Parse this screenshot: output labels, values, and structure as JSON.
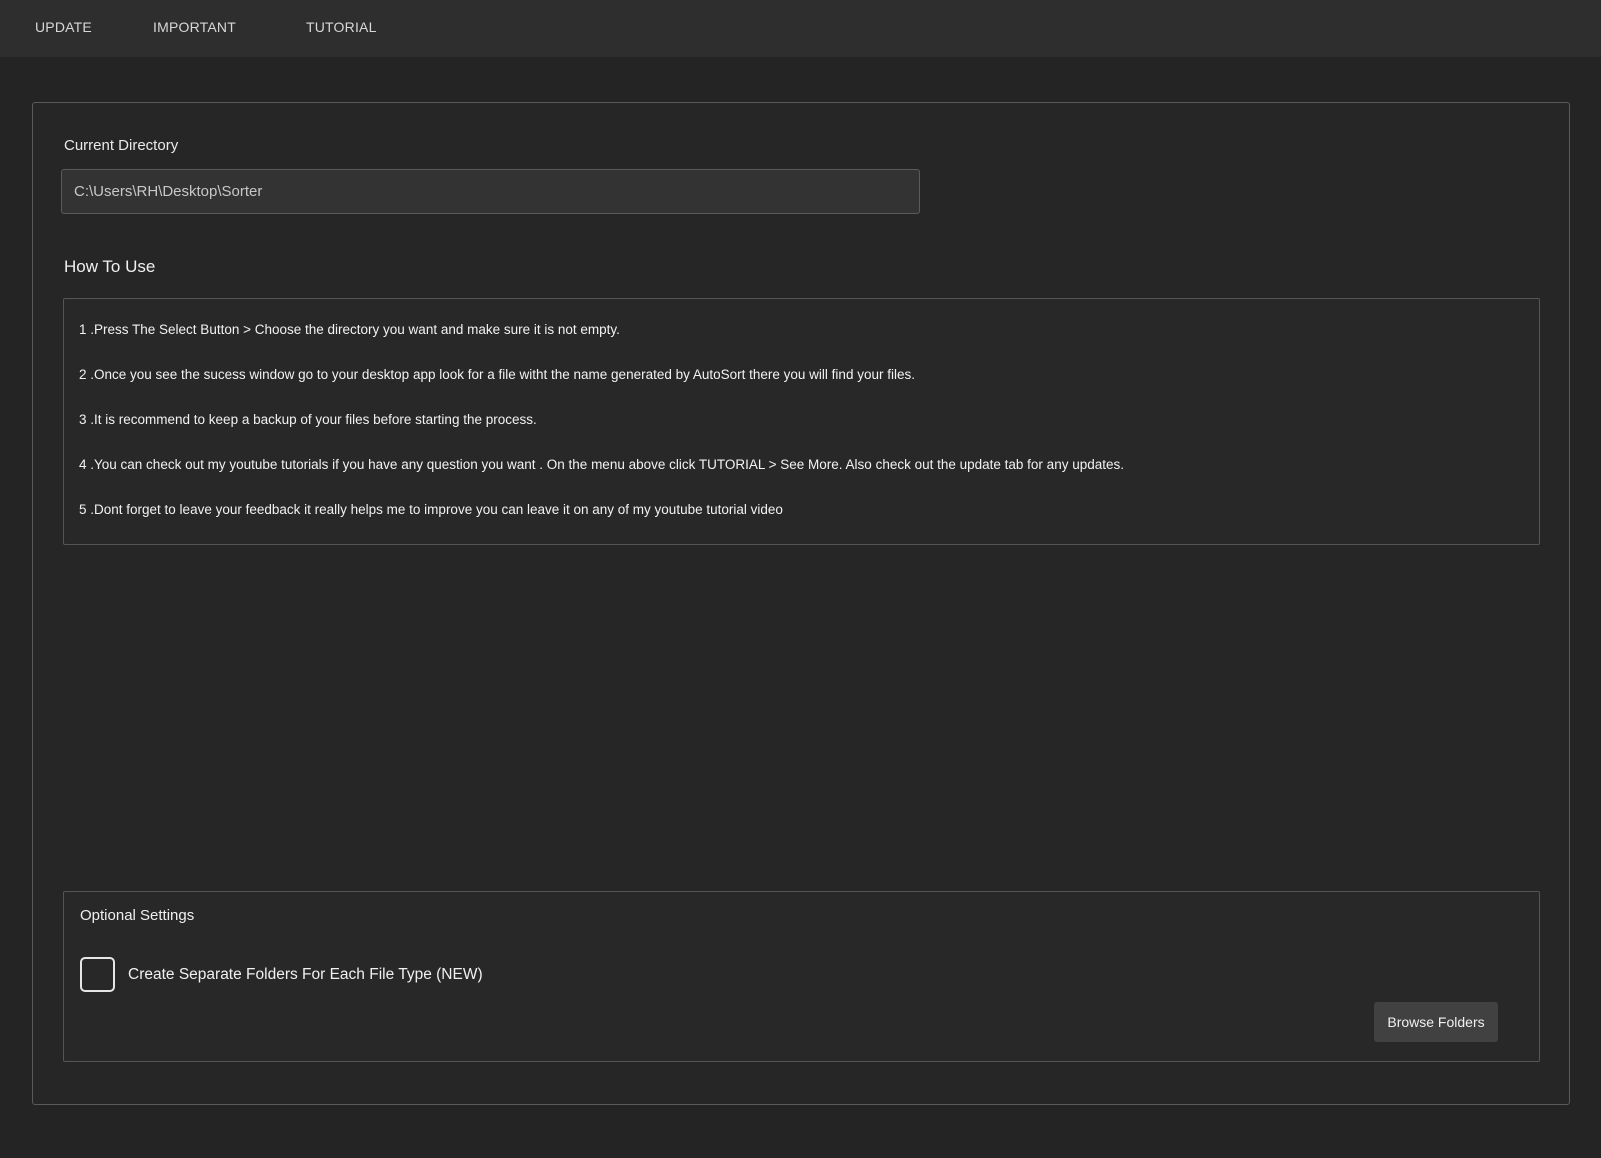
{
  "menu": {
    "items": [
      {
        "label": "UPDATE"
      },
      {
        "label": "IMPORTANT"
      },
      {
        "label": "TUTORIAL"
      }
    ]
  },
  "directory": {
    "label": "Current Directory",
    "value": "C:\\Users\\RH\\Desktop\\Sorter"
  },
  "how_to_use": {
    "title": "How To Use",
    "steps": [
      "1 .Press The Select Button > Choose the directory you want and make sure it is not empty.",
      "2 .Once you see the sucess window go to your desktop app look for a file witht the name generated by AutoSort there you will find your files.",
      "3 .It is recommend to keep a backup of your files before starting the process.",
      "4 .You can check out my youtube tutorials if you have any question you want . On the menu above click TUTORIAL > See More. Also check out the update tab for any updates.",
      "5 .Dont forget to leave your feedback it really helps me to improve you can leave it on any of my youtube tutorial video"
    ]
  },
  "optional_settings": {
    "title": "Optional Settings",
    "separate_folders_label": "Create Separate Folders For Each File Type (NEW)",
    "separate_folders_checked": false,
    "browse_label": "Browse Folders"
  },
  "colors": {
    "background": "#242424",
    "menubar": "#2e2e2e",
    "border": "#5a5a5a",
    "button": "#414141"
  }
}
